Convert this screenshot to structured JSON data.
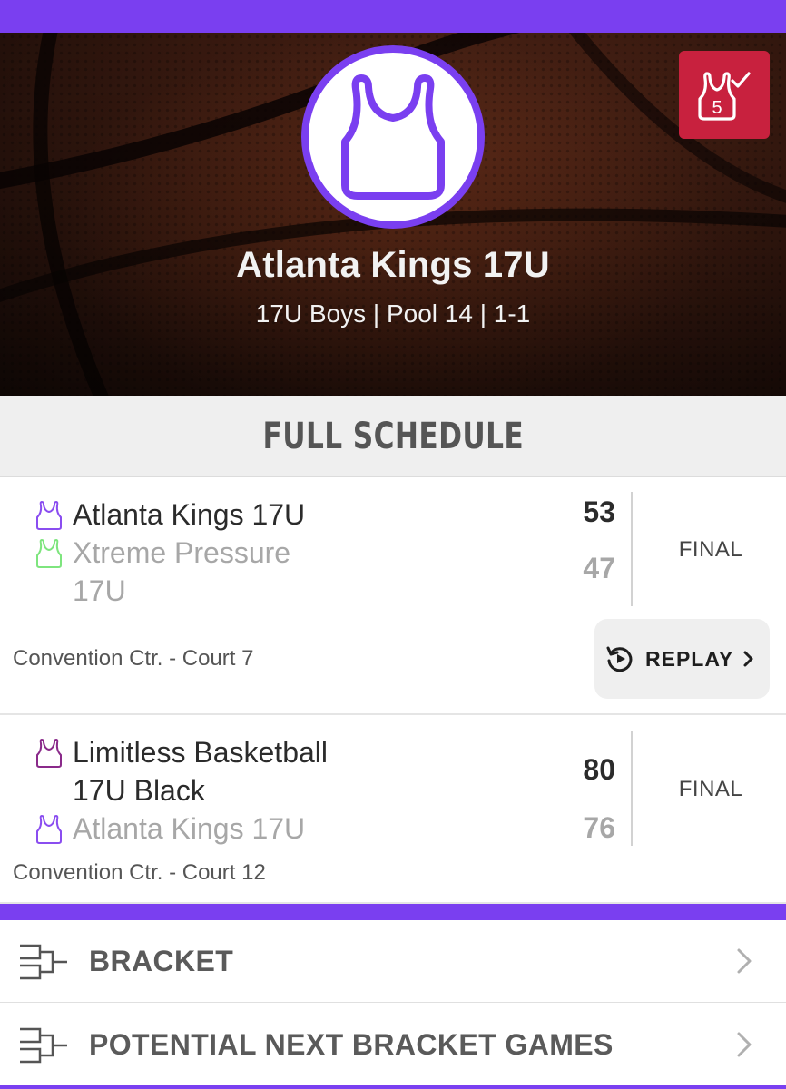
{
  "colors": {
    "accent": "#7a3ff0",
    "badge": "#c8213e",
    "team_home_jersey": "#8a4df0",
    "team_xtreme_jersey": "#7ee57e",
    "team_limitless_jersey": "#8a2a8a"
  },
  "header": {
    "team_name": "Atlanta Kings 17U",
    "subtitle": "17U Boys | Pool 14 | 1-1",
    "logo_icon": "jersey-icon",
    "badge_icon": "jersey-check-icon",
    "badge_number": "5"
  },
  "schedule": {
    "title": "FULL SCHEDULE",
    "games": [
      {
        "team1": "Atlanta Kings 17U",
        "team1_score": "53",
        "team2": "Xtreme Pressure 17U",
        "team2_score": "47",
        "status": "FINAL",
        "venue": "Convention Ctr. - Court 7",
        "replay_label": "REPLAY"
      },
      {
        "team1": "Limitless Basketball 17U Black",
        "team1_score": "80",
        "team2": "Atlanta Kings 17U",
        "team2_score": "76",
        "status": "FINAL",
        "venue": "Convention Ctr. - Court 12"
      }
    ]
  },
  "nav": [
    {
      "label": "BRACKET",
      "icon": "bracket-icon"
    },
    {
      "label": "POTENTIAL NEXT BRACKET GAMES",
      "icon": "bracket-icon"
    }
  ]
}
